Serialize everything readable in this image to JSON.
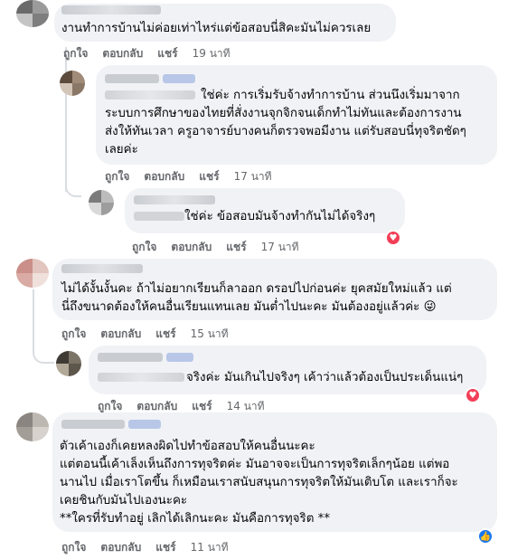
{
  "actions": {
    "like": "ถูกใจ",
    "reply": "ตอบกลับ",
    "share": "แชร์"
  },
  "comments": [
    {
      "text": "งานทำการบ้านไม่ค่อยเท่าไหร่แต่ข้อสอบนี่สิคะมันไม่ควรเลย",
      "time": "19 นาที"
    },
    {
      "text_lines": [
        "ใช่ค่ะ การเริ่มรับจ้างทำการบ้าน ส่วนนึงเริ่มมาจาก",
        "ระบบการศึกษาของไทยที่สั่งงานจุกจิกจนเด็กทำไม่ทันและต้องการงาน",
        "ส่งให้ทันเวลา ครูอาจารย์บางคนก็ตรวจพอมีงาน แต่รับสอบนี่ทุจริตชัดๆ",
        "เลยค่ะ"
      ],
      "time": "17 นาที"
    },
    {
      "text": "ใช่ค่ะ ข้อสอบมันจ้างทำกันไม่ได้จริงๆ",
      "time": "17 นาที",
      "reaction": "heart-icon"
    },
    {
      "text_lines": [
        "ไม่ได้งั้นงั้นคะ ถ้าไม่อยากเรียนก็ลาออก ดรอปไปก่อนค่ะ ยุคสมัยใหม่แล้ว แต่",
        "นี่ถึงขนาดต้องให้คนอื่นเรียนแทนเลย มันต่ำไปนะคะ มันต้องอยู่แล้วค่ะ 😜"
      ],
      "time": "15 นาที"
    },
    {
      "text": "จริงค่ะ มันเกินไปจริงๆ เค้าว่าแล้วต้องเป็นประเด็นแน่ๆ",
      "time": "14 นาที",
      "reaction": "heart-icon"
    },
    {
      "text_lines": [
        "ตัวเค้าเองก็เคยหลงผิดไปทำข้อสอบให้คนอื่นนะคะ",
        "แต่ตอนนี้เค้าเล็งเห็นถึงการทุจริตค่ะ มันอาจจะเป็นการทุจริตเล็กๆน้อย แต่พอ",
        "นานไป เมื่อเราโตขึ้น ก็เหมือนเราสนับสนุนการทุจริตให้มันเติบโต และเราก็จะ",
        "เคยชินกับมันไปเองนะคะ",
        "**ใครที่รับทำอยู่ เลิกได้เลิกนะคะ มันคือการทุจริต **"
      ],
      "time": "11 นาที",
      "reaction": "like-icon"
    }
  ],
  "colors": {
    "bubble": "#f0f2f5",
    "meta": "#65676b",
    "heart": "#f33e58",
    "like": "#1877f2"
  }
}
